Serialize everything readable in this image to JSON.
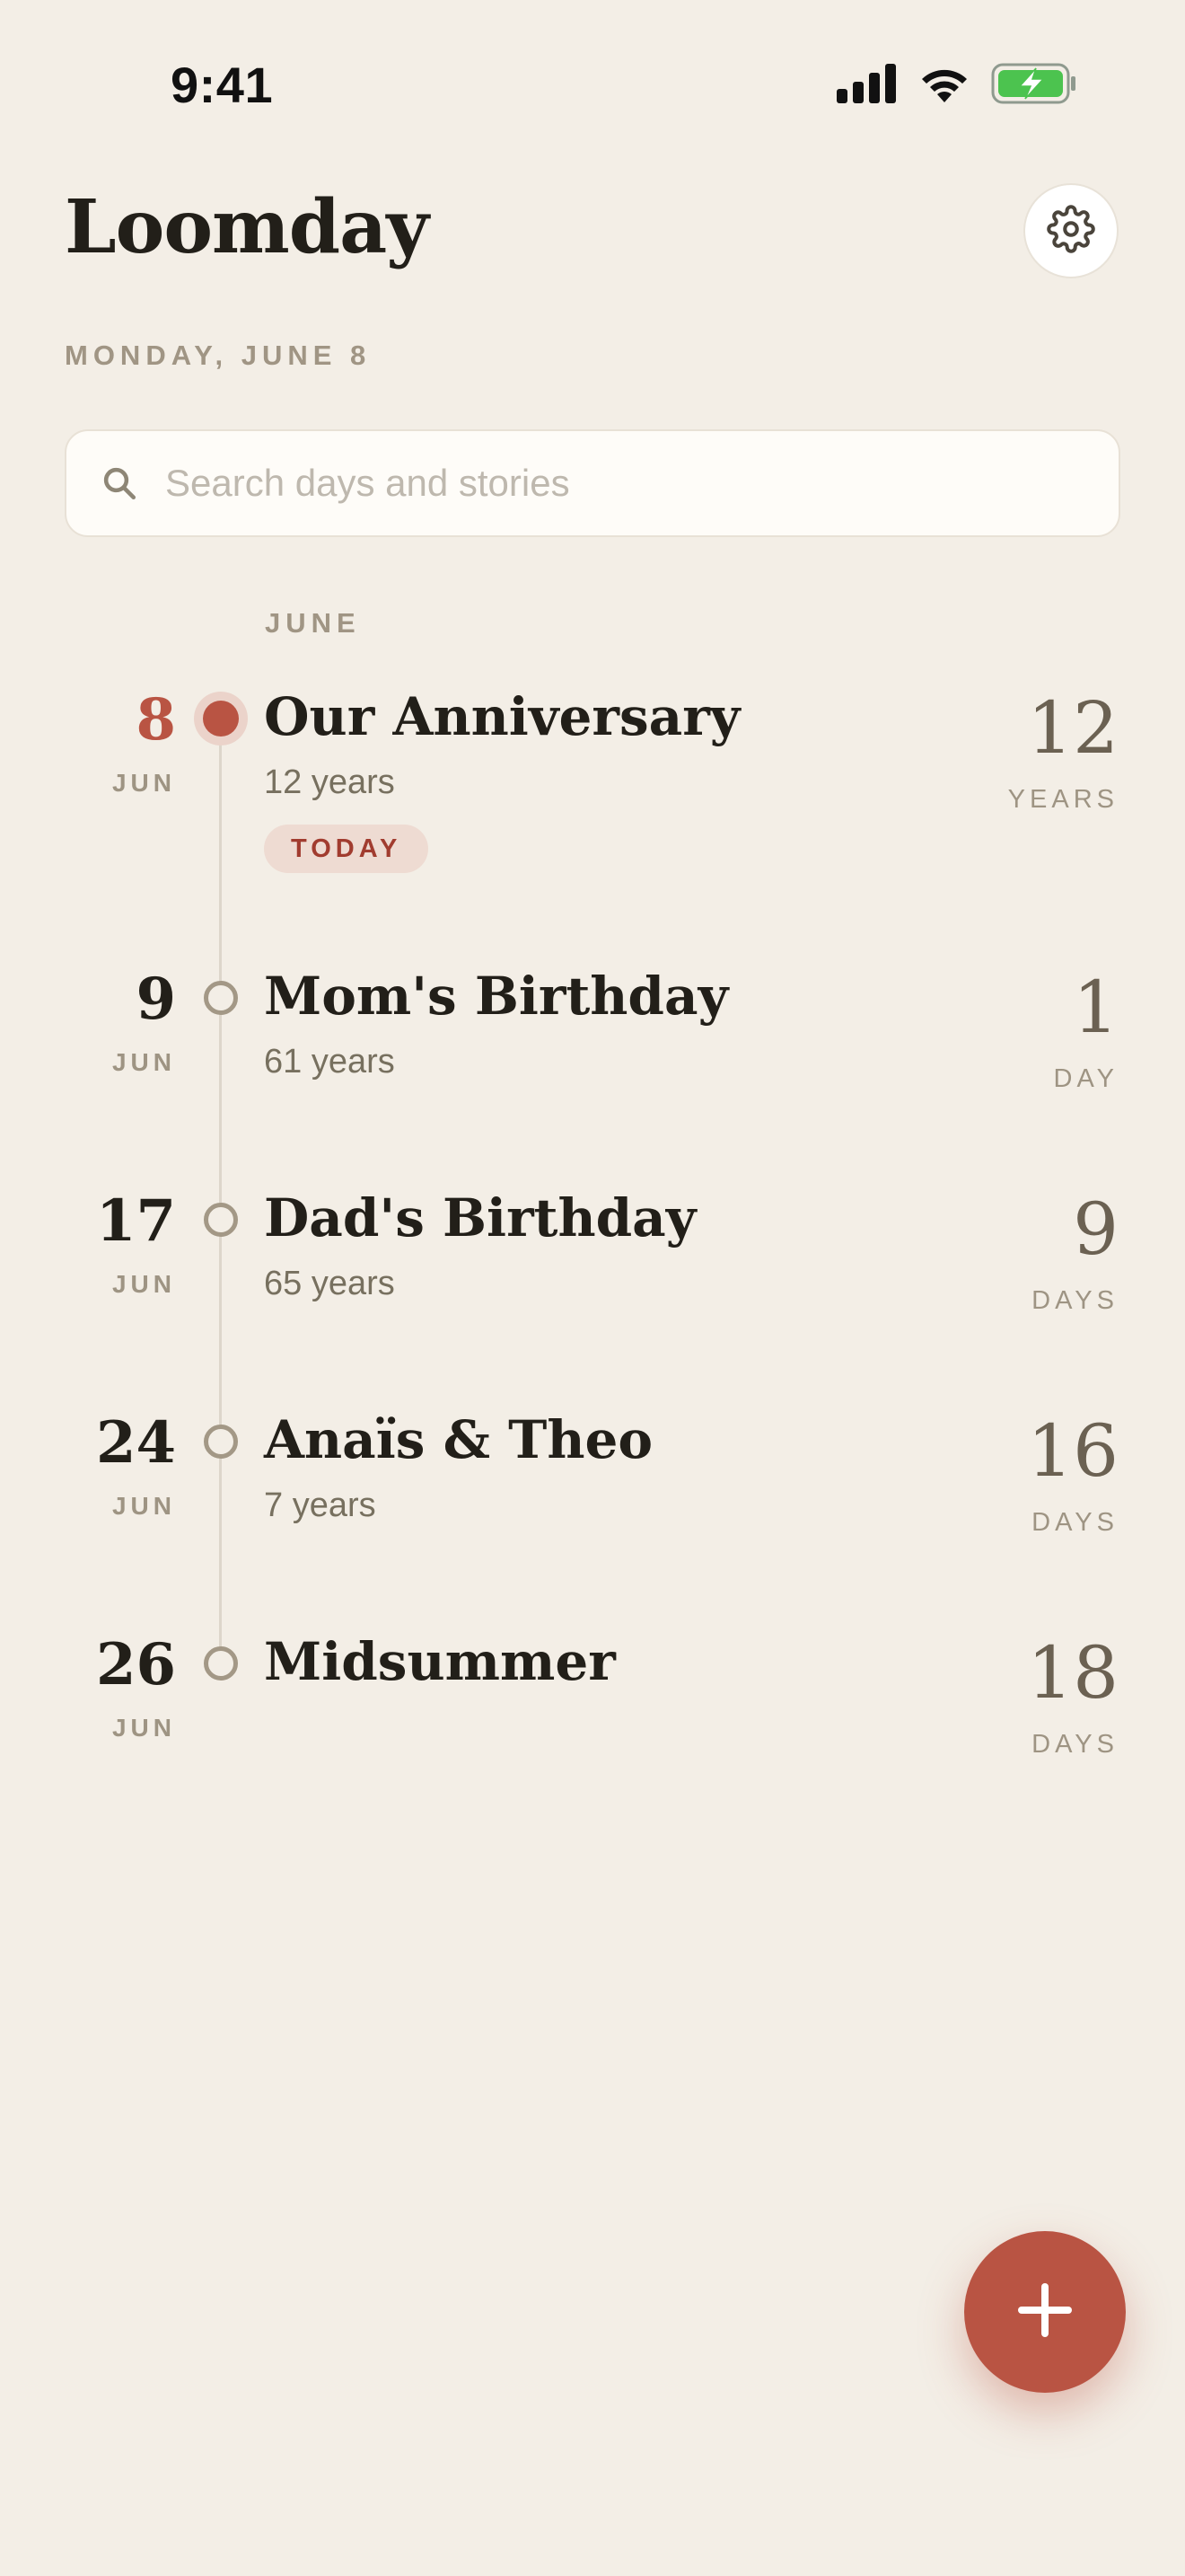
{
  "status_bar": {
    "time": "9:41"
  },
  "header": {
    "title": "Loomday",
    "date": "MONDAY, JUNE 8"
  },
  "search": {
    "placeholder": "Search days and stories",
    "value": ""
  },
  "timeline": {
    "month": "JUNE",
    "events": [
      {
        "day": "8",
        "month": "JUN",
        "title": "Our Anniversary",
        "subtitle": "12 years",
        "badge": "TODAY",
        "count": "12",
        "unit": "YEARS"
      },
      {
        "day": "9",
        "month": "JUN",
        "title": "Mom's Birthday",
        "subtitle": "61 years",
        "count": "1",
        "unit": "DAY"
      },
      {
        "day": "17",
        "month": "JUN",
        "title": "Dad's Birthday",
        "subtitle": "65 years",
        "count": "9",
        "unit": "DAYS"
      },
      {
        "day": "24",
        "month": "JUN",
        "title": "Anaïs & Theo",
        "subtitle": "7 years",
        "count": "16",
        "unit": "DAYS"
      },
      {
        "day": "26",
        "month": "JUN",
        "title": "Midsummer",
        "count": "18",
        "unit": "DAYS"
      }
    ]
  },
  "icons": [
    "cellular-signal-icon",
    "wifi-icon",
    "battery-charging-icon",
    "gear-icon",
    "search-icon",
    "plus-icon"
  ],
  "colors": {
    "accent": "#B95443",
    "background": "#F3EEE6",
    "badge_bg": "#EEDBD2",
    "battery_green": "#4CC34F"
  }
}
